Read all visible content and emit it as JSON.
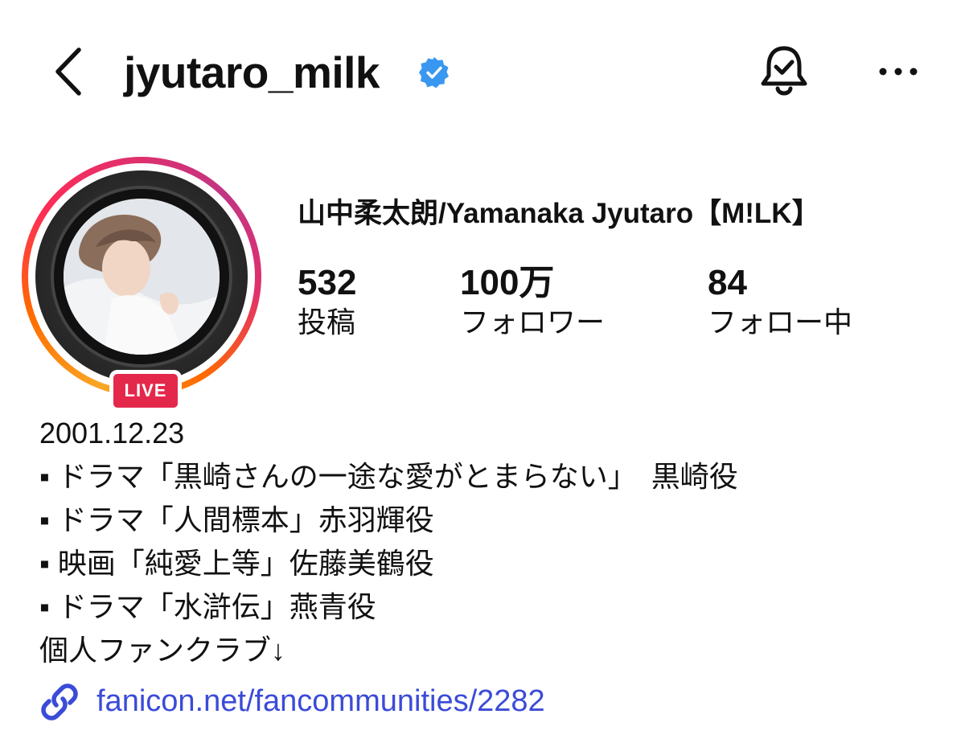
{
  "header": {
    "username": "jyutaro_milk",
    "icons": {
      "back": "back-chevron-icon",
      "verified": "verified-badge-icon",
      "notify": "bell-check-icon",
      "more": "more-horizontal-icon"
    }
  },
  "profile": {
    "display_name": "山中柔太朗/Yamanaka Jyutaro【M!LK】",
    "live_badge": "LIVE",
    "ring_colors": [
      "#f9a825",
      "#ff2d55",
      "#c13584"
    ],
    "stats": [
      {
        "value": "532",
        "label": "投稿"
      },
      {
        "value": "100万",
        "label": "フォロワー"
      },
      {
        "value": "84",
        "label": "フォロー中"
      }
    ]
  },
  "bio": {
    "lines": [
      "2001.12.23",
      "▪ ドラマ「黒崎さんの一途な愛がとまらない」　黒崎役",
      "▪ ドラマ「人間標本」赤羽輝役",
      "▪ 映画「純愛上等」佐藤美鶴役",
      "▪ ドラマ「水滸伝」燕青役",
      "個人ファンクラブ↓"
    ]
  },
  "link": {
    "icon": "link-icon",
    "url_text": "fanicon.net/fancommunities/2282",
    "color": "#3b4bd8"
  }
}
